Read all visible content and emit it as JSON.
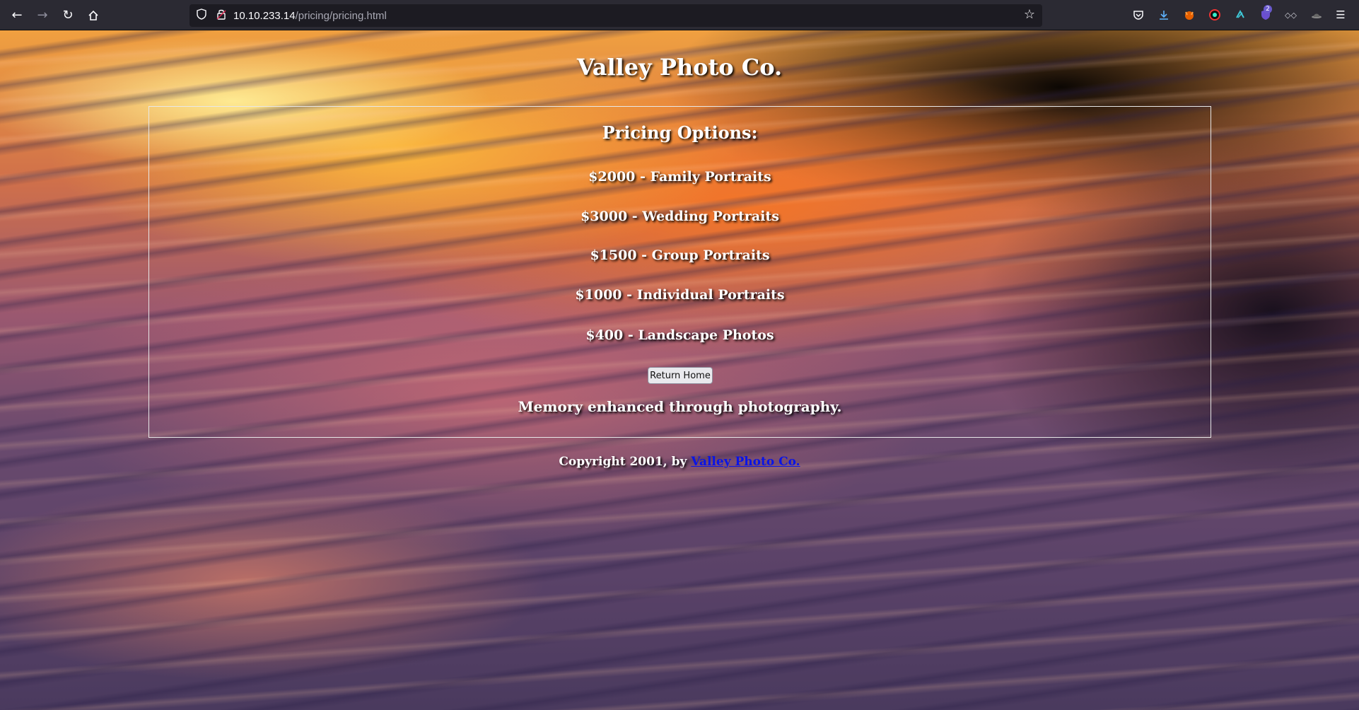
{
  "browser": {
    "url_host": "10.10.233.14",
    "url_path": "/pricing/pricing.html",
    "extension_badge": "2"
  },
  "page": {
    "site_title": "Valley Photo Co.",
    "pricing_heading": "Pricing Options:",
    "prices": [
      "$2000 - Family Portraits",
      "$3000 - Wedding Portraits",
      "$1500 - Group Portraits",
      "$1000 - Individual Portraits",
      "$400 - Landscape Photos"
    ],
    "return_button": "Return Home",
    "tagline": "Memory enhanced through photography.",
    "footer_prefix": "Copyright 2001, by",
    "footer_link": "Valley Photo Co."
  },
  "colors": {
    "link": "#0a14e6",
    "heading_text": "#ffffff",
    "panel_border": "#e8e8e8"
  }
}
